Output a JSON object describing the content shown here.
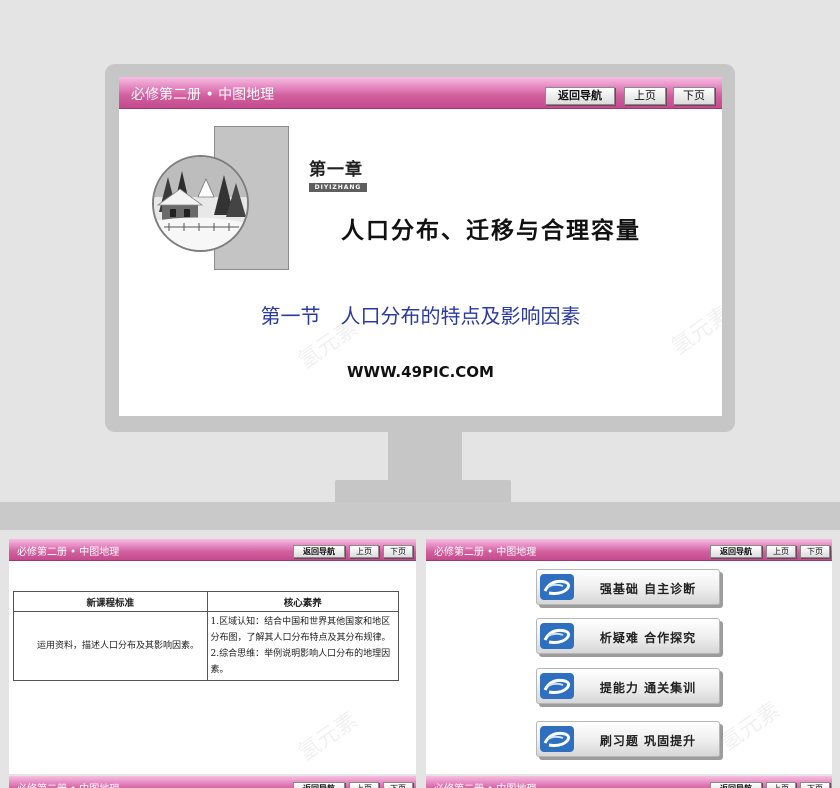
{
  "header": {
    "title": "必修第二册 • 中图地理",
    "return_label": "返回导航",
    "prev_label": "上页",
    "next_label": "下页"
  },
  "title_slide": {
    "chapter": "第一章",
    "chapter_pinyin": "DIYIZHANG",
    "main_title": "人口分布、迁移与合理容量",
    "section": "第一节　人口分布的特点及影响因素",
    "url": "WWW.49PIC.COM"
  },
  "standards_slide": {
    "col1_header": "新课程标准",
    "col2_header": "核心素养",
    "left_text": "运用资料，描述人口分布及其影响因素。",
    "right_items": [
      "1.区域认知：结合中国和世界其他国家和地区分布图，了解其人口分布特点及其分布规律。",
      "2.综合思维：举例说明影响人口分布的地理因素。"
    ]
  },
  "menu_slide": {
    "items": [
      {
        "label": "强基础 自主诊断"
      },
      {
        "label": "析疑难 合作探究"
      },
      {
        "label": "提能力 通关集训"
      },
      {
        "label": "刷习题 巩固提升"
      }
    ]
  },
  "watermark": "氢元素",
  "colors": {
    "header_pink": "#d2609e",
    "section_blue": "#2b3a9e",
    "icon_blue": "#2f6fc0"
  }
}
